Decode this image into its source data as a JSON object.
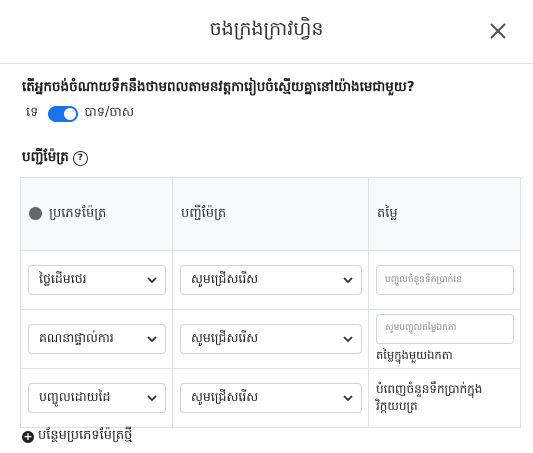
{
  "modal": {
    "title": "ចងក្រងក្រាវហ្វិន"
  },
  "question": "តើអ្នកចង់ចំណាយទឹកនឹងថាមពលតាមនវត្តការៀបចំស្មើយគ្នានៅយ៉ាងមេជាមួយ?",
  "toggle": {
    "no_label": "ទេ",
    "yes_label": "បាទ/ចាស",
    "state": "on"
  },
  "meters": {
    "section_label": "បញ្ជីម៉ែត្រ",
    "headers": [
      "ប្រភេទម៉ែត្រ",
      "បញ្ជីម៉ែត្រ",
      "តម្លៃ"
    ],
    "rows": [
      {
        "type": "ថ្លៃដើមថេរ",
        "list": "សូមជ្រើសរើស",
        "value_placeholder": "បញ្ចូលចំនួនទឹកប្រាក់នេ",
        "value_note": ""
      },
      {
        "type": "គណនាផ្ទាល់ការ",
        "list": "សូមជ្រើសរើស",
        "value_placeholder": "សូមបញ្ចូលតម្លៃឯកតា",
        "value_note": "តម្លៃក្នុងមួយឯកតា"
      },
      {
        "type": "បញ្ចូលដោយដៃ",
        "list": "សូមជ្រើសរើស",
        "value_placeholder": "",
        "value_note": "បំពេញចំនួនទឹកប្រាក់ក្នុងវិក្កយបត្រ"
      }
    ],
    "add_label": "បន្ថែមប្រភេទម៉ែត្រថ្មី"
  },
  "colors": {
    "accent": "#1a73e8",
    "border": "#dee2e6",
    "header_bg": "#f8f9fa"
  }
}
